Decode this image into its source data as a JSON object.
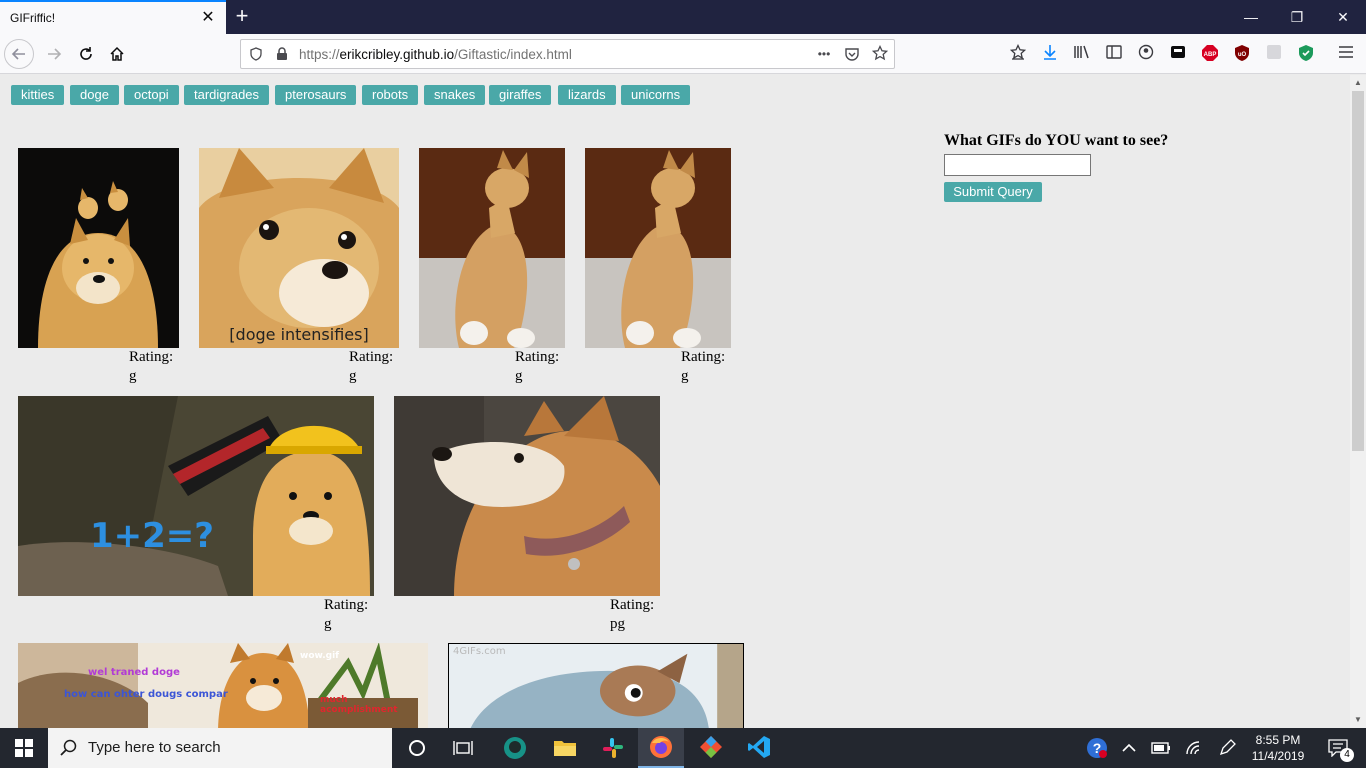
{
  "browser": {
    "tab_title": "GIFriffic!",
    "tab_close": "✕",
    "new_tab": "+",
    "url_scheme": "https://",
    "url_host": "erikcribley.github.io",
    "url_path": "/Giftastic/index.html",
    "url_more": "•••",
    "minimize": "—",
    "restore": "❐",
    "close": "✕"
  },
  "topics": [
    "kitties",
    "doge",
    "octopi",
    "tardigrades",
    "pterosaurs",
    "robots",
    "snakes",
    "giraffes",
    "lizards",
    "unicorns"
  ],
  "gifs": [
    {
      "rating_label": "Rating:",
      "rating": "g",
      "caption": ""
    },
    {
      "rating_label": "Rating:",
      "rating": "g",
      "caption": "[doge intensifies]"
    },
    {
      "rating_label": "Rating:",
      "rating": "g",
      "caption": ""
    },
    {
      "rating_label": "Rating:",
      "rating": "g",
      "caption": ""
    },
    {
      "rating_label": "Rating:",
      "rating": "g",
      "caption": "1+2=?"
    },
    {
      "rating_label": "Rating:",
      "rating": "pg",
      "caption": ""
    },
    {
      "caption": "wel traned doge",
      "caption2": "how can ohter dougs compar",
      "caption3": "wow.gif",
      "caption4": "much acomplishment"
    },
    {
      "caption": "4GIFs.com"
    }
  ],
  "form": {
    "title": "What GIFs do YOU want to see?",
    "submit_label": "Submit Query"
  },
  "taskbar": {
    "search_placeholder": "Type here to search",
    "time": "8:55 PM",
    "date": "11/4/2019",
    "notifications": "4"
  },
  "colors": {
    "button_teal": "#4aa8a8",
    "page_bg": "#ebebeb",
    "tab_strip": "#202340",
    "taskbar": "#23272f"
  }
}
